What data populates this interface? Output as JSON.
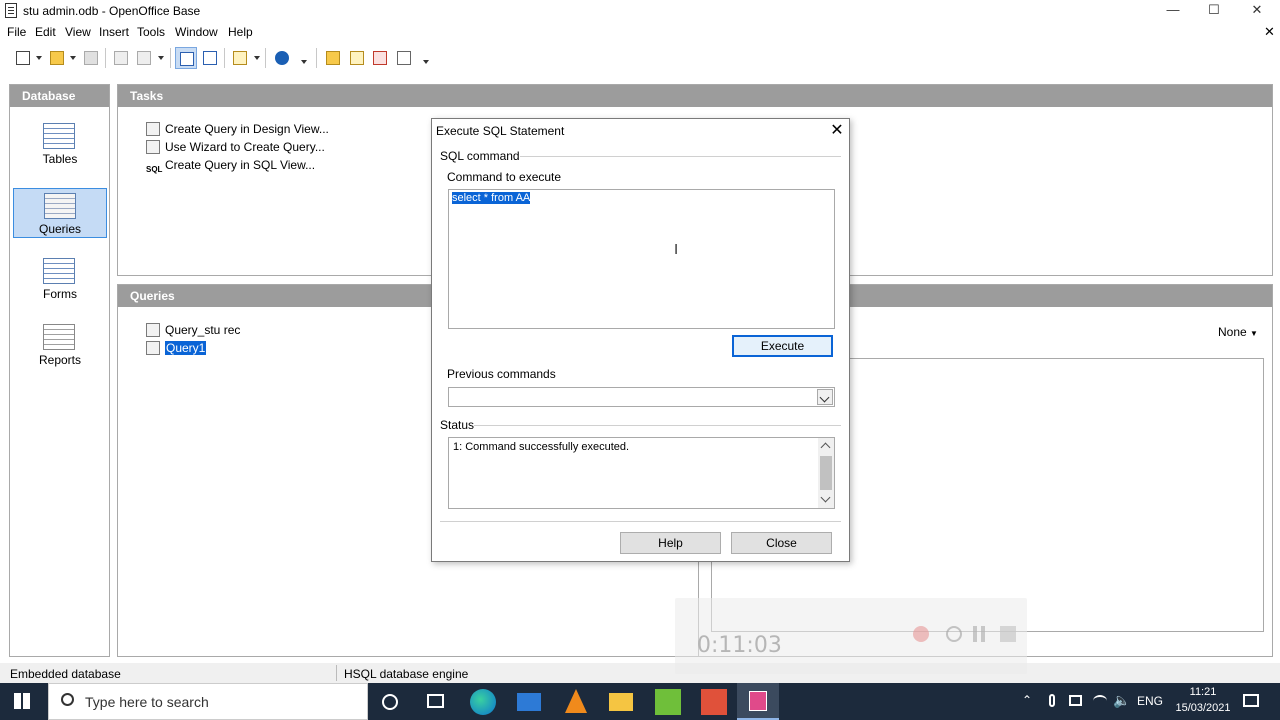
{
  "window": {
    "title": "stu admin.odb - OpenOffice Base",
    "controls": {
      "minimize": "—",
      "maximize": "☐",
      "close": "✕"
    },
    "doc_close": "✕"
  },
  "menu": [
    "File",
    "Edit",
    "View",
    "Insert",
    "Tools",
    "Window",
    "Help"
  ],
  "menu_underlines": [
    "F",
    "E",
    "V",
    "I",
    "T",
    "W",
    "H"
  ],
  "database_panel": {
    "header": "Database",
    "items": [
      {
        "label": "Tables",
        "icon": "table-icon"
      },
      {
        "label": "Queries",
        "icon": "query-icon",
        "selected": true
      },
      {
        "label": "Forms",
        "icon": "form-icon"
      },
      {
        "label": "Reports",
        "icon": "report-icon"
      }
    ]
  },
  "tasks_panel": {
    "header": "Tasks",
    "items": [
      "Create Query in Design View...",
      "Use Wizard to Create Query...",
      "Create Query in SQL View..."
    ]
  },
  "queries_panel": {
    "header": "Queries",
    "items": [
      "Query_stu rec",
      "Query1"
    ],
    "selected_index": 1,
    "preview_select": "None"
  },
  "statusbar": {
    "left": "Embedded database",
    "middle": "HSQL database engine"
  },
  "recording": {
    "time": "0:11:03"
  },
  "dialog": {
    "title": "Execute SQL Statement",
    "close": "✕",
    "group_sql": "SQL command",
    "command_label": "Command to execute",
    "command_value": "select * from AA",
    "execute_button": "Execute",
    "previous_label": "Previous commands",
    "previous_value": "",
    "status_label": "Status",
    "status_text": "1: Command successfully executed.",
    "help_button": "Help",
    "close_button": "Close"
  },
  "taskbar": {
    "search_placeholder": "Type here to search",
    "time": "11:21",
    "date": "15/03/2021",
    "language": "ENG"
  },
  "colors": {
    "panel_header": "#9c9c9c",
    "selection": "#0a64d6",
    "taskbar": "#1c2a3c"
  }
}
